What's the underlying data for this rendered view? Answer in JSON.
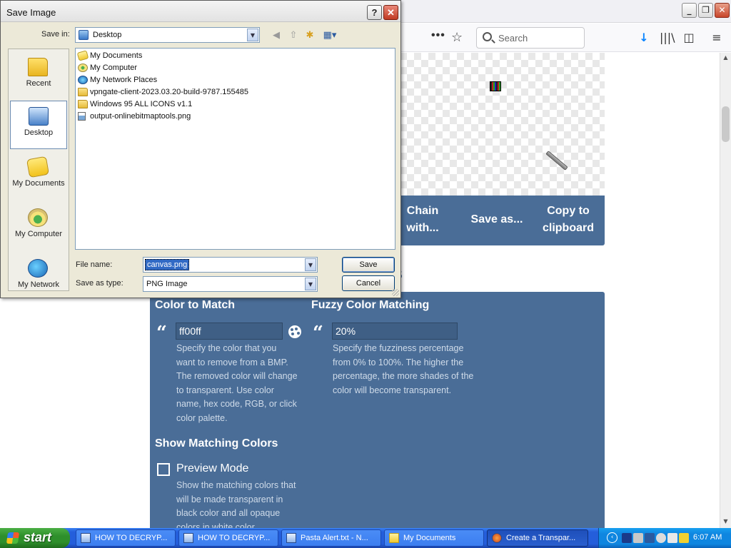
{
  "dialog": {
    "title": "Save Image",
    "help_glyph": "?",
    "close_glyph": "✕",
    "save_in_label": "Save in:",
    "save_in_value": "Desktop",
    "places": [
      {
        "label": "Recent"
      },
      {
        "label": "Desktop"
      },
      {
        "label": "My Documents"
      },
      {
        "label": "My Computer"
      },
      {
        "label": "My Network"
      }
    ],
    "files": [
      {
        "name": "My Documents",
        "icon": "my-documents-icon"
      },
      {
        "name": "My Computer",
        "icon": "my-computer-icon"
      },
      {
        "name": "My Network Places",
        "icon": "network-places-icon"
      },
      {
        "name": "vpngate-client-2023.03.20-build-9787.155485",
        "icon": "folder-icon"
      },
      {
        "name": "Windows 95 ALL ICONS v1.1",
        "icon": "folder-icon"
      },
      {
        "name": "output-onlinebitmaptools.png",
        "icon": "png-file-icon"
      }
    ],
    "file_name_label": "File name:",
    "file_name_value": "canvas.png",
    "save_as_type_label": "Save as type:",
    "save_as_type_value": "PNG Image",
    "save_button": "Save",
    "cancel_button": "Cancel"
  },
  "browser": {
    "more_glyph": "•••",
    "star_glyph": "☆",
    "search_placeholder": "Search",
    "download_glyph": "↓",
    "library_glyph": "|||\\",
    "sidebar_glyph": "◫",
    "menu_glyph": "≡",
    "min_glyph": "_",
    "max_glyph": "❐",
    "close_glyph": "✕"
  },
  "page": {
    "action_buttons": {
      "chain": "Chain with...",
      "save_as": "Save as...",
      "copy": "Copy to clipboard"
    },
    "section_heading": "ns",
    "options": {
      "color_match_title": "Color to Match",
      "color_match_value": "ff00ff",
      "color_match_desc": "Specify the color that you want to remove from a BMP. The removed color will change to transparent. Use color name, hex code, RGB, or click color palette.",
      "fuzzy_title": "Fuzzy Color Matching",
      "fuzzy_value": "20%",
      "fuzzy_desc": "Specify the fuzziness percentage from 0% to 100%. The higher the percentage, the more shades of the color will become transparent.",
      "show_matching_title": "Show Matching Colors",
      "preview_label": "Preview Mode",
      "preview_desc": "Show the matching colors that will be made transparent in black color and all opaque colors in white color."
    },
    "quote_glyph": "“"
  },
  "taskbar": {
    "start_label": "start",
    "tasks": [
      {
        "label": "HOW TO DECRYP..."
      },
      {
        "label": "HOW TO DECRYP..."
      },
      {
        "label": "Pasta Alert.txt - N..."
      },
      {
        "label": "My Documents"
      },
      {
        "label": "Create a Transpar..."
      }
    ],
    "tray_chevron": "‹",
    "clock": "6:07 AM"
  },
  "colors": {
    "page_accent": "#4a6d97",
    "taskbar_blue": "#245edb",
    "start_green": "#2e8f2b",
    "dialog_face": "#ece9d8"
  }
}
